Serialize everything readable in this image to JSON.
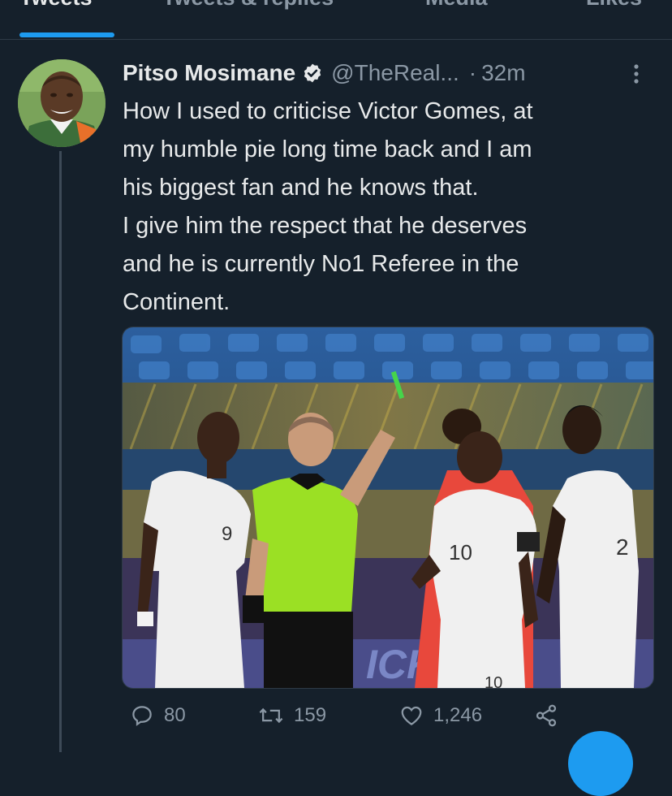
{
  "tabs": [
    {
      "label": "Tweets"
    },
    {
      "label": "Tweets & replies"
    },
    {
      "label": "Media"
    },
    {
      "label": "Likes"
    }
  ],
  "tweet": {
    "display_name": "Pitso Mosimane",
    "handle": "@TheReal...",
    "separator": "·",
    "time": "32m",
    "text_lines": [
      "How I used to criticise Victor Gomes, at",
      "my humble pie long time back and I am",
      "his biggest fan and he knows that.",
      "I give him the respect that he deserves",
      "and he is currently No1 Referee in the",
      "Continent."
    ],
    "media_board_text": "ICKE",
    "jersey_numbers": [
      "9",
      "10",
      "2",
      "10"
    ]
  },
  "actions": {
    "replies": "80",
    "retweets": "159",
    "likes": "1,246"
  },
  "colors": {
    "background": "#15202b",
    "accent": "#1d9bf0",
    "muted": "#8b98a5",
    "referee_shirt": "#9be024"
  },
  "icons": [
    "verified-badge-icon",
    "more-options-icon",
    "reply-icon",
    "retweet-icon",
    "like-icon",
    "share-icon"
  ]
}
